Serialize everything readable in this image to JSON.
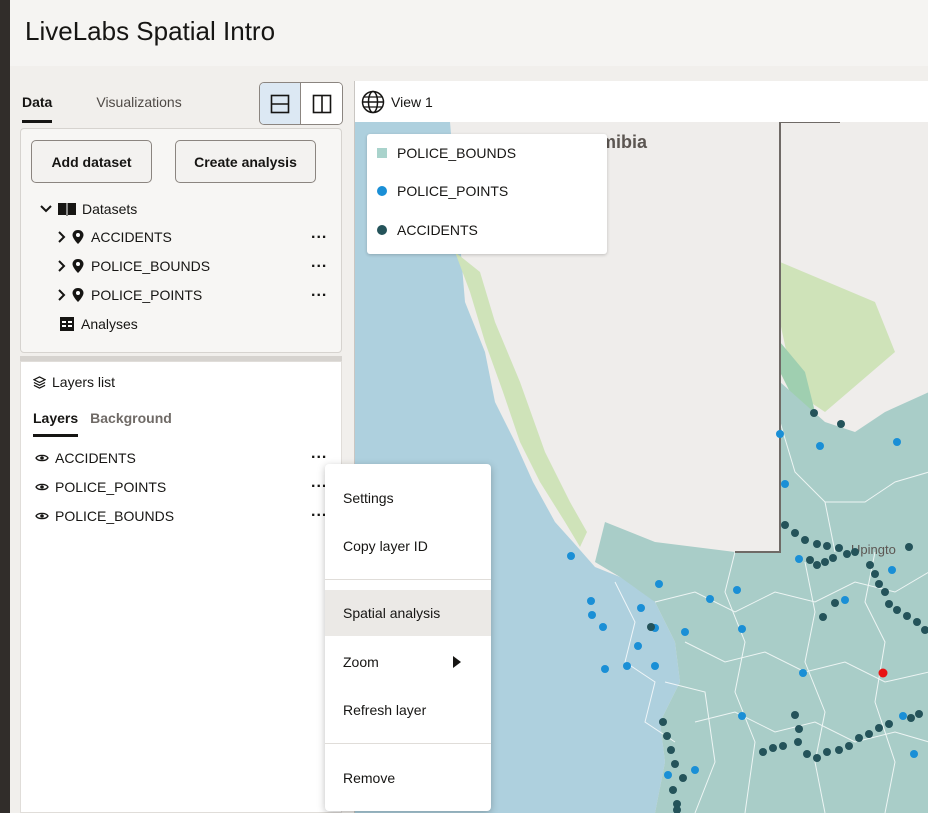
{
  "app": {
    "title": "LiveLabs Spatial Intro"
  },
  "left_panel": {
    "tabs": [
      {
        "label": "Data",
        "active": true
      },
      {
        "label": "Visualizations",
        "active": false
      }
    ],
    "add_dataset_label": "Add dataset",
    "create_analysis_label": "Create analysis",
    "datasets_label": "Datasets",
    "datasets": [
      {
        "name": "ACCIDENTS",
        "more": "..."
      },
      {
        "name": "POLICE_BOUNDS",
        "more": "..."
      },
      {
        "name": "POLICE_POINTS",
        "more": "..."
      }
    ],
    "analyses_label": "Analyses"
  },
  "layers_panel": {
    "title": "Layers list",
    "tabs": [
      {
        "label": "Layers",
        "active": true
      },
      {
        "label": "Background",
        "active": false
      }
    ],
    "layers": [
      {
        "name": "ACCIDENTS",
        "more": "..."
      },
      {
        "name": "POLICE_POINTS",
        "more": "..."
      },
      {
        "name": "POLICE_BOUNDS",
        "more": "..."
      }
    ]
  },
  "view": {
    "title": "View 1",
    "map_label": "mibia",
    "map_label_2": "Upingto",
    "legend": [
      {
        "name": "POLICE_BOUNDS",
        "symbol": "square",
        "color": "#a9d3cc"
      },
      {
        "name": "POLICE_POINTS",
        "symbol": "circle",
        "color": "#1a8fd6"
      },
      {
        "name": "ACCIDENTS",
        "symbol": "circle",
        "color": "#24535a"
      }
    ]
  },
  "context_menu": {
    "items": [
      "Settings",
      "Copy layer ID",
      "Spatial analysis",
      "Zoom",
      "Refresh layer",
      "Remove"
    ],
    "highlighted": "Spatial analysis"
  },
  "colors": {
    "sea": "#aed0de",
    "land": "#efedeb",
    "bounds_fill": "#a9cdc8",
    "police_point": "#1a8fd6",
    "accident": "#24535a",
    "highlight_point": "#e81313",
    "active_layout": "#dce8f3"
  }
}
